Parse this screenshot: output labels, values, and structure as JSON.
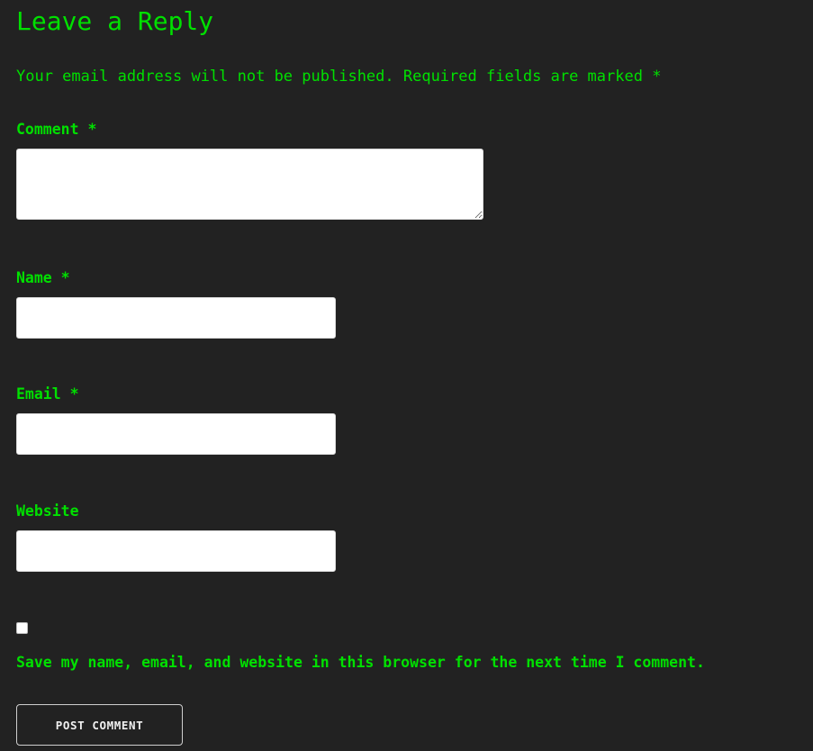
{
  "reply": {
    "title": "Leave a Reply",
    "notes": "Your email address will not be published. Required fields are marked *"
  },
  "fields": {
    "comment": {
      "label": "Comment *",
      "value": ""
    },
    "name": {
      "label": "Name *",
      "value": ""
    },
    "email": {
      "label": "Email *",
      "value": ""
    },
    "website": {
      "label": "Website",
      "value": ""
    }
  },
  "consent": {
    "checked": false,
    "label": "Save my name, email, and website in this browser for the next time I comment."
  },
  "submit": {
    "label": "POST COMMENT"
  },
  "colors": {
    "background": "#222222",
    "text_accent": "#00e000",
    "input_background": "#ffffff",
    "button_border": "#cfcfcf",
    "button_text": "#f0f0f0"
  }
}
